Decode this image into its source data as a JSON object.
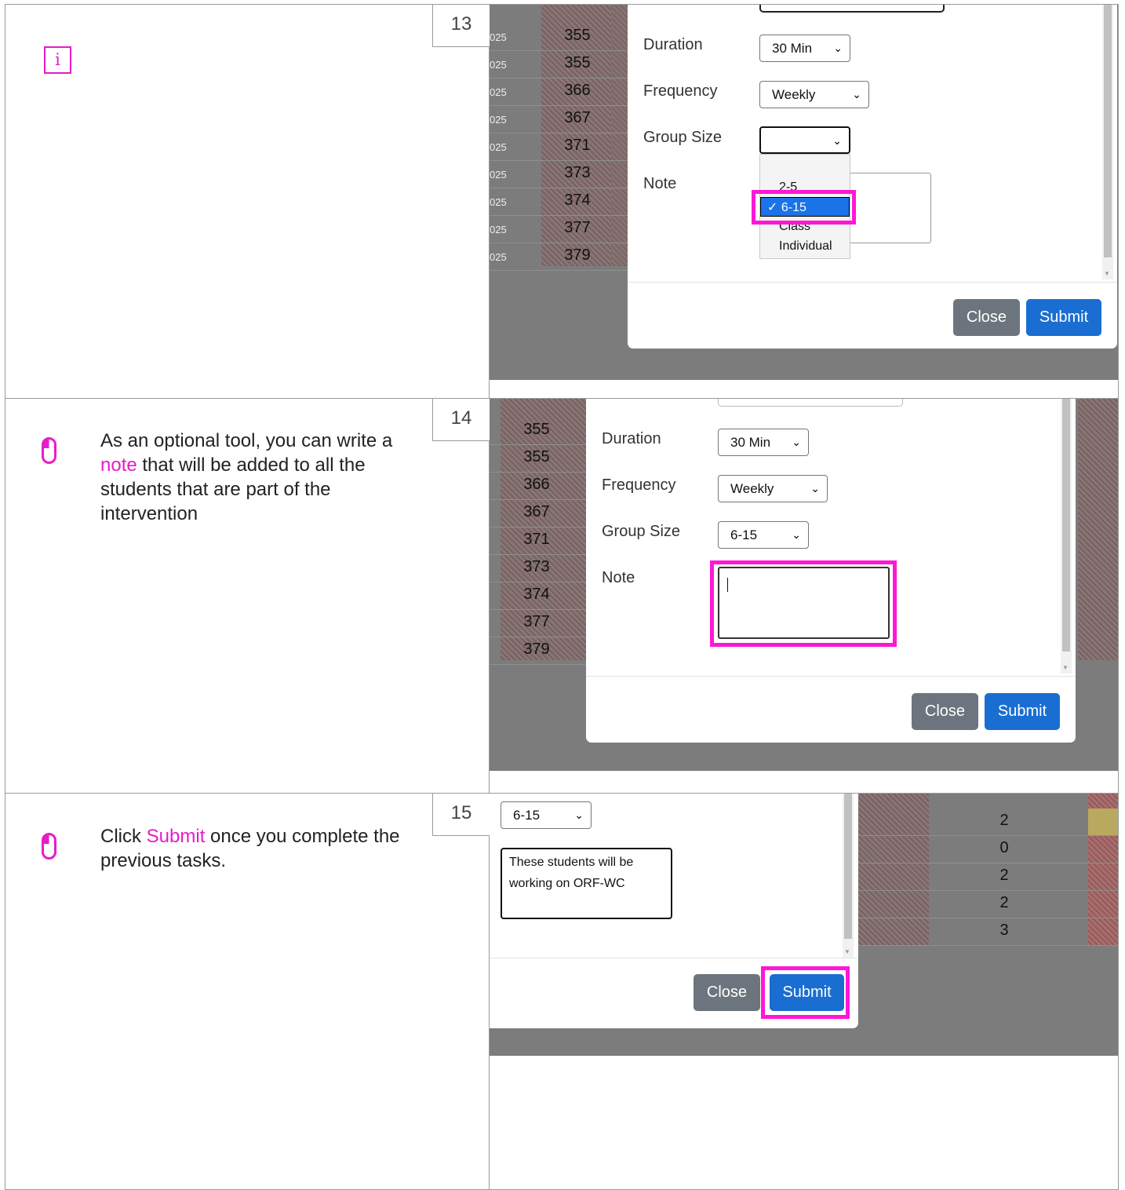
{
  "steps": [
    {
      "number": "13",
      "icon": "info-icon",
      "text": ""
    },
    {
      "number": "14",
      "icon": "mouse-icon",
      "text_before": "As an optional tool, you can write a ",
      "highlight": "note",
      "text_after": " that will be added to all the students that are part of the intervention"
    },
    {
      "number": "15",
      "icon": "mouse-icon",
      "text_before": "Click ",
      "highlight": "Submit",
      "text_after": " once you complete the previous tasks."
    }
  ],
  "info_glyph": "i",
  "form": {
    "duration_label": "Duration",
    "duration_value": "30 Min",
    "frequency_label": "Frequency",
    "frequency_value": "Weekly",
    "group_size_label": "Group Size",
    "group_size_value": "6-15",
    "note_label": "Note",
    "group_size_options": [
      "2-5",
      "6-15",
      "Class",
      "Individual"
    ],
    "checkmark": "✓",
    "note_value_line1": "These students will be",
    "note_value_line2": "working on ORF-WC",
    "close_label": "Close",
    "submit_label": "Submit"
  },
  "background_table": {
    "year_suffix": "025",
    "ids": [
      "355",
      "355",
      "366",
      "367",
      "371",
      "373",
      "374",
      "377",
      "379"
    ],
    "step15_values": [
      "2",
      "0",
      "2",
      "2",
      "3"
    ]
  },
  "colors": {
    "highlight": "#ff17d6",
    "submit": "#1a6ed1",
    "close": "#6c757d"
  }
}
